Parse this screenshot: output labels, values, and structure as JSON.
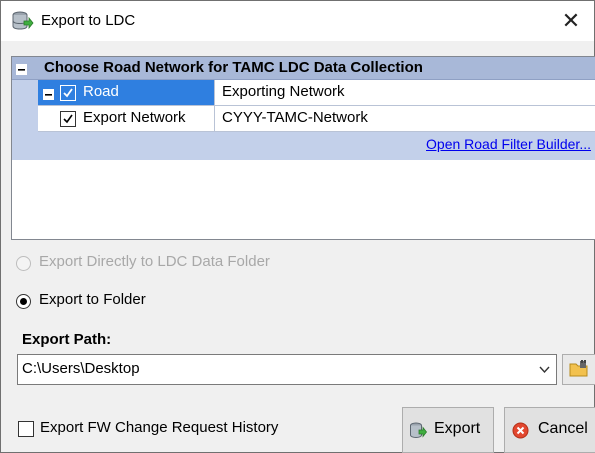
{
  "window": {
    "title": "Export to LDC",
    "close_glyph": "✕",
    "app_icon": "database-export-icon"
  },
  "tree": {
    "header": "Choose Road Network for TAMC LDC Data Collection",
    "rows": [
      {
        "name": "Road",
        "value": "Exporting Network",
        "checked": true,
        "selected": true
      },
      {
        "name": "Export Network",
        "value": "CYYY-TAMC-Network",
        "checked": true,
        "selected": false
      }
    ],
    "link": "Open Road Filter Builder..."
  },
  "options": {
    "direct": {
      "label": "Export Directly to LDC Data Folder",
      "enabled": false,
      "selected": false
    },
    "folder": {
      "label": "Export to Folder",
      "enabled": true,
      "selected": true
    }
  },
  "export_path": {
    "label": "Export Path:",
    "value": "C:\\Users\\Desktop"
  },
  "history_checkbox": {
    "label": "Export FW Change Request History",
    "checked": false
  },
  "buttons": {
    "export": "Export",
    "cancel": "Cancel"
  },
  "colors": {
    "selection": "#2f7fe0",
    "header_band": "#a8b8d8",
    "link": "#0000ee",
    "cancel_icon": "#e2472f"
  }
}
